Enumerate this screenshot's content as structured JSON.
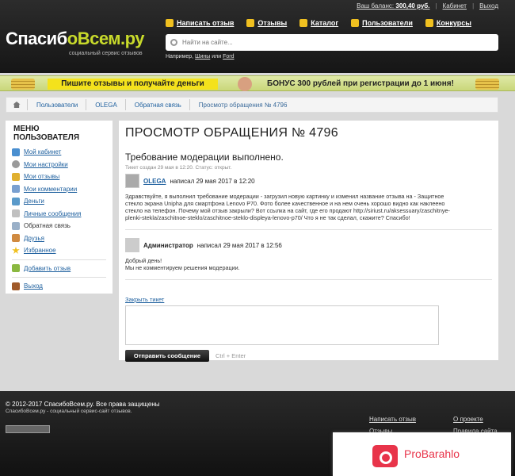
{
  "header": {
    "balance_label": "Ваш баланс:",
    "balance_value": "300,40 руб.",
    "cabinet_link": "Кабинет",
    "logout_link": "Выход",
    "logo_part1": "Спасиб",
    "logo_part2": "оВсем.ру",
    "tagline": "социальный сервис отзывов",
    "nav": [
      {
        "label": "Написать отзыв",
        "icon": "pencil-icon"
      },
      {
        "label": "Отзывы",
        "icon": "comment-icon"
      },
      {
        "label": "Каталог",
        "icon": "folder-icon"
      },
      {
        "label": "Пользователи",
        "icon": "users-icon"
      },
      {
        "label": "Конкурсы",
        "icon": "lightbulb-icon"
      }
    ],
    "search_placeholder": "Найти на сайте...",
    "example_prefix": "Например,",
    "example_link1": "Шины",
    "example_or": "или",
    "example_link2": "Ford"
  },
  "banner": {
    "left_text": "Пишите отзывы и получайте деньги",
    "right_text": "БОНУС 300 рублей при регистрации до 1 июня!"
  },
  "breadcrumb": [
    "Пользователи",
    "OLEGA",
    "Обратная связь",
    "Просмотр обращения № 4796"
  ],
  "sidebar": {
    "title": "МЕНЮ ПОЛЬЗОВАТЕЛЯ",
    "items": [
      {
        "label": "Мой кабинет",
        "color": "#4a8fd0"
      },
      {
        "label": "Мои настройки",
        "color": "#9a9a9a"
      },
      {
        "label": "Мои отзывы",
        "color": "#e0b030"
      },
      {
        "label": "Мои комментарии",
        "color": "#7aa0d0"
      },
      {
        "label": "Деньги",
        "color": "#5a9aca"
      },
      {
        "label": "Личные сообщения",
        "color": "#c0c0c0"
      },
      {
        "label": "Обратная связь",
        "color": "#9ab0c8"
      },
      {
        "label": "Друзья",
        "color": "#d08a40"
      },
      {
        "label": "Избранное",
        "color": "#f0c020"
      }
    ],
    "add_review": "Добавить отзыв",
    "logout": "Выход"
  },
  "ticket": {
    "page_title": "ПРОСМОТР ОБРАЩЕНИЯ № 4796",
    "subject": "Требование модерации выполнено.",
    "meta": "Тикет создан 29 мая в 12:20. Статус: открыт.",
    "user_name": "OLEGA",
    "user_wrote": "написал 29 мая 2017 в 12:20",
    "user_message": "Здравствуйте, я выполнил требование модерации - загрузил новую картинку и изменил название отзыва на - Защитное стекло экрана Unipha для смартфона Lenovo P70. Фото более качественное и на нем очень хорошо видно как наклеено стекло на телефон. Почему мой отзыв закрыли? Вот ссылка на сайт, где его продают http://siriust.ru/aksessuary/zaschitnye-plenki-stekla/zaschitnoe-steklo/zaschitnoe-steklo-displeya-lenovo-p70/ Что я не так сделал, скажите? Спасибо!",
    "admin_name": "Администратор",
    "admin_wrote": "написал 29 мая 2017 в 12:56",
    "admin_line1": "Добрый день!",
    "admin_line2": "Мы не комментируем решения модерации.",
    "close_link": "Закрыть тикет",
    "send_button": "Отправить сообщение",
    "send_hint": "Ctrl + Enter"
  },
  "footer": {
    "copyright": "© 2012-2017 СпасибоВсем.ру. Все права защищены",
    "subline": "СпасибоВсем.ру - социальный сервис-сайт отзывов.",
    "col1": [
      "Написать отзыв",
      "Отзывы"
    ],
    "col2": [
      "О проекте",
      "Правила сайта"
    ]
  },
  "ad": {
    "text": "ProBarahlo"
  }
}
